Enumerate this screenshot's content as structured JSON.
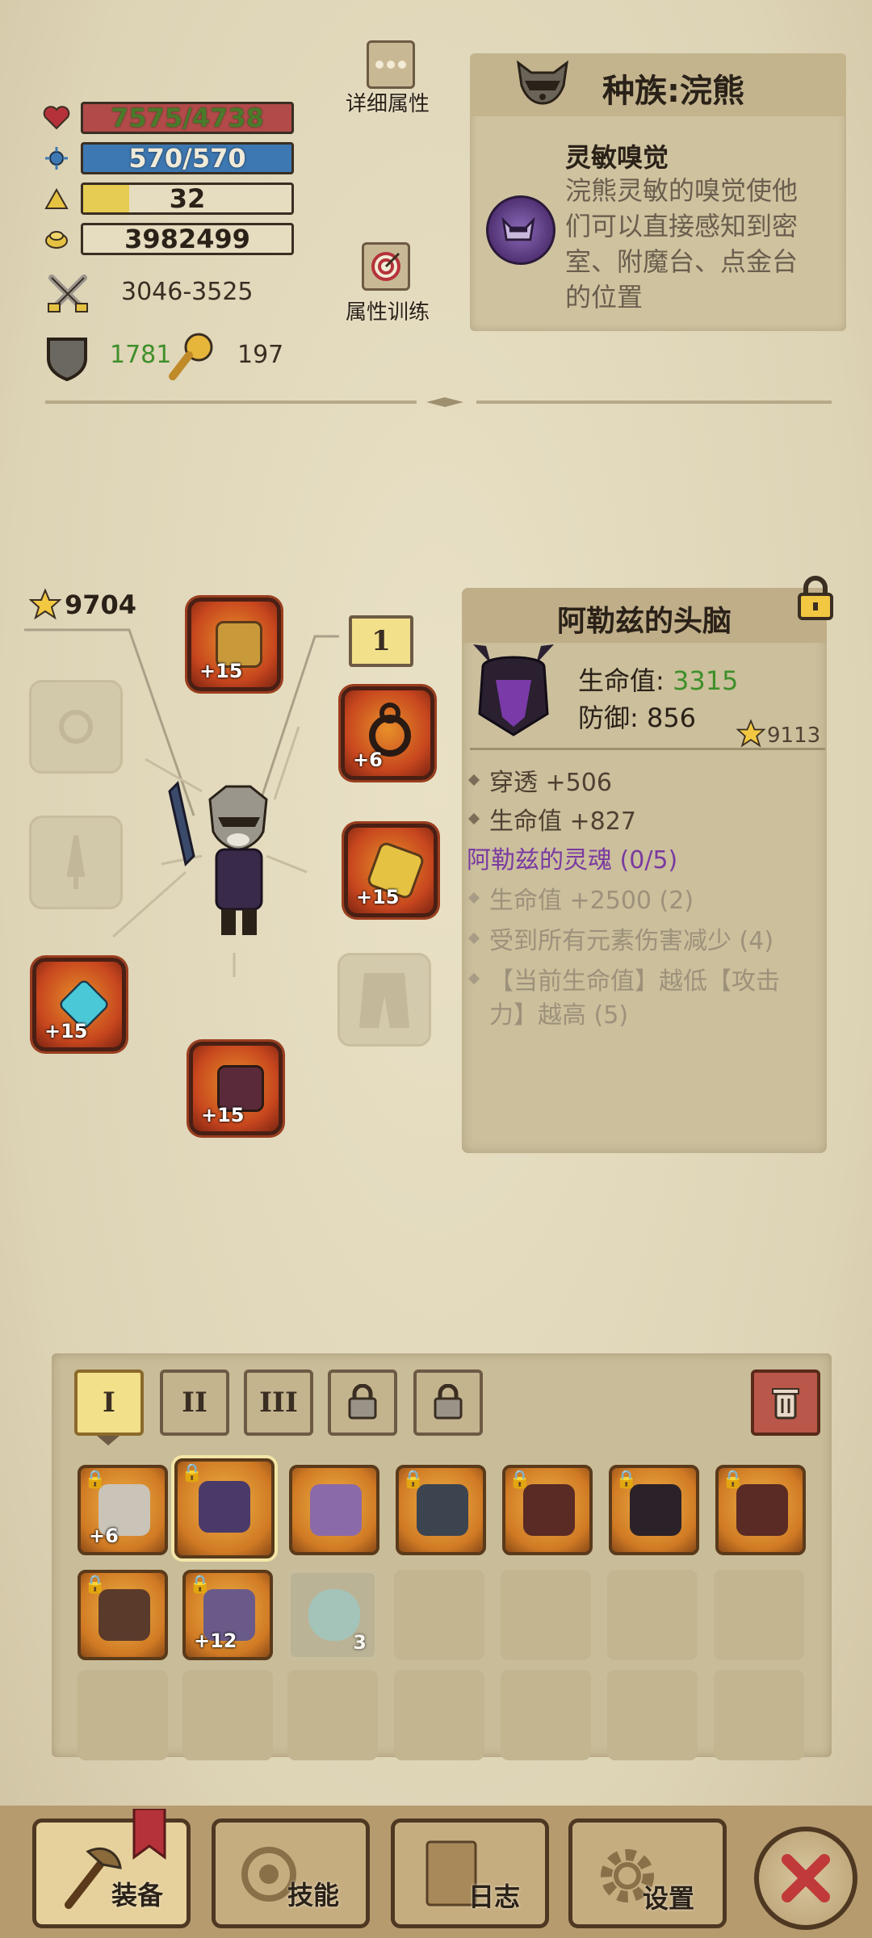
{
  "stats": {
    "hp": "7575/4738",
    "mp": "570/570",
    "level": "32",
    "gold": "3982499",
    "attack": "3046-3525",
    "defense": "1781",
    "special": "197"
  },
  "buttons": {
    "details": "详细属性",
    "training": "属性训练"
  },
  "race": {
    "title": "种族:浣熊",
    "skill_name": "灵敏嗅觉",
    "skill_desc": "浣熊灵敏的嗅觉使他们可以直接感知到密室、附魔台、点金台的位置"
  },
  "equipment": {
    "score": "9704",
    "tier_badge": "1",
    "helmet_plus": "+15",
    "ring_plus": "+6",
    "weapon_plus": "+15",
    "amulet_plus": "+15",
    "armor_plus": "+15"
  },
  "item_detail": {
    "name": "阿勒兹的头脑",
    "hp_label": "生命值:",
    "hp_value": "3315",
    "defense": "防御: 856",
    "score": "9113",
    "attrs": [
      "穿透 +506",
      "生命值 +827"
    ],
    "set_name": "阿勒兹的灵魂 (0/5)",
    "set_bonuses": [
      "生命值 +2500 (2)",
      "受到所有元素伤害减少 (4)",
      "【当前生命值】越低【攻击",
      "力】越高 (5)"
    ]
  },
  "bag": {
    "tabs": [
      "I",
      "II",
      "III"
    ],
    "items": [
      {
        "plus": "+6",
        "color": "#c9c3b8"
      },
      {
        "plus": "",
        "color": "#4a3a6a"
      },
      {
        "plus": "",
        "color": "#8a6aa8"
      },
      {
        "plus": "",
        "color": "#3c4450"
      },
      {
        "plus": "",
        "color": "#5a2a24"
      },
      {
        "plus": "",
        "color": "#2a2228"
      },
      {
        "plus": "",
        "color": "#5a2a24"
      },
      {
        "plus": "",
        "color": "#5a3a2a"
      },
      {
        "plus": "+12",
        "color": "#6a5a8a"
      }
    ],
    "potion_qty": "3"
  },
  "nav": {
    "equip": "装备",
    "skills": "技能",
    "log": "日志",
    "settings": "设置"
  },
  "colors": {
    "hp_green": "#3f8f2a",
    "set_purple": "#7a3aa0"
  }
}
